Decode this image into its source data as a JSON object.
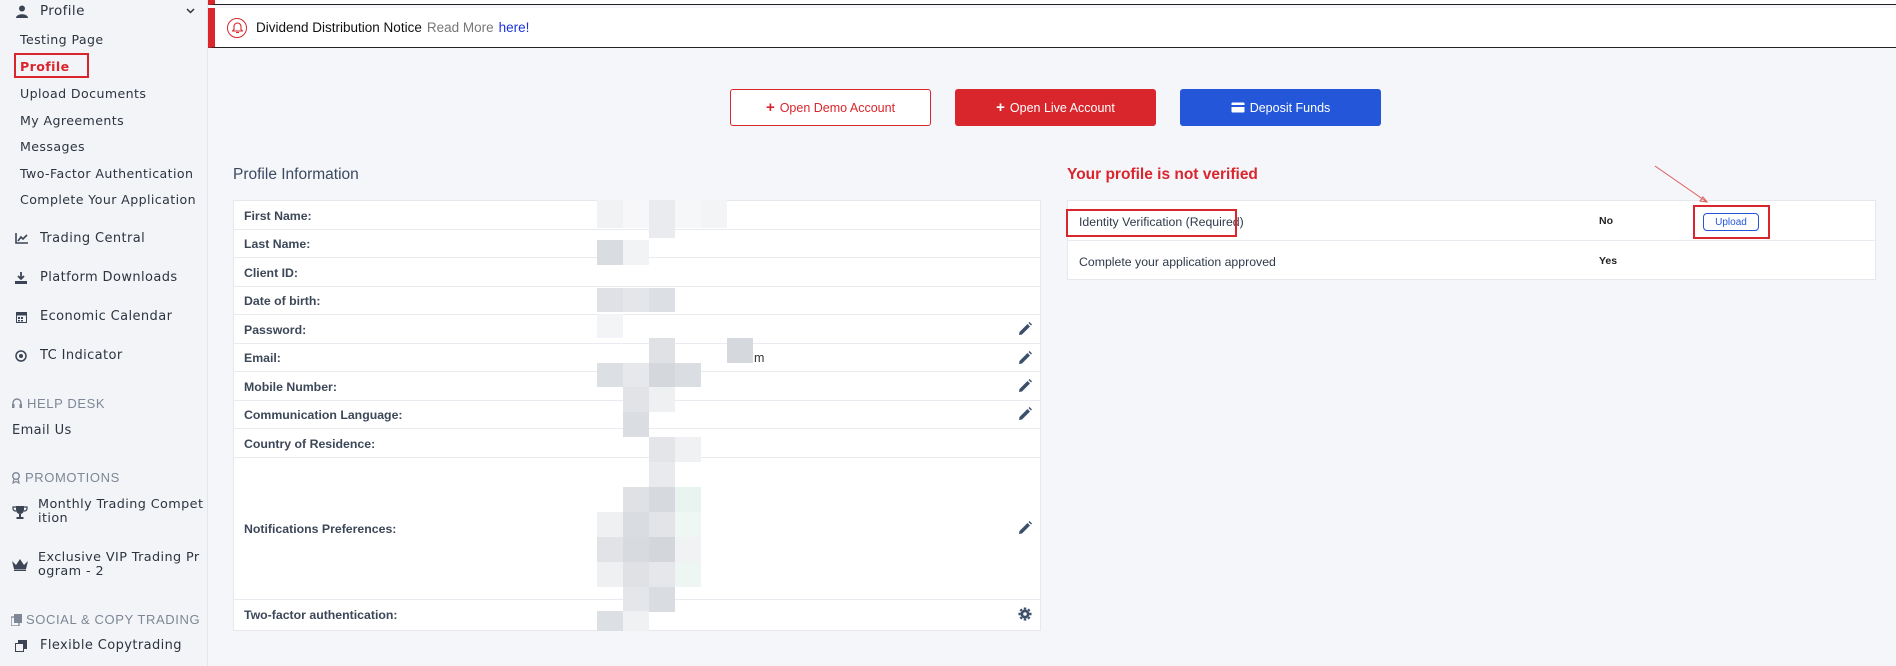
{
  "sidebar": {
    "profile_header": "Profile",
    "profile_sub": [
      "Testing Page",
      "Profile",
      "Upload Documents",
      "My Agreements",
      "Messages",
      "Two-Factor Authentication",
      "Complete Your Application"
    ],
    "main_items": [
      {
        "label": "Trading Central",
        "icon": "chart-icon"
      },
      {
        "label": "Platform Downloads",
        "icon": "download-icon"
      },
      {
        "label": "Economic Calendar",
        "icon": "calendar-icon"
      },
      {
        "label": "TC Indicator",
        "icon": "target-icon"
      }
    ],
    "help_desk": {
      "title": "HELP DESK",
      "items": [
        "Email Us"
      ]
    },
    "promotions": {
      "title": "PROMOTIONS",
      "items": [
        "Monthly Trading Compet\nition",
        "Exclusive VIP Trading Pr\nogram - 2"
      ]
    },
    "social": {
      "title": "SOCIAL & COPY TRADING",
      "items": [
        "Flexible Copytrading"
      ]
    }
  },
  "notice": {
    "title": "Dividend Distribution Notice",
    "read_more": "Read More",
    "link": "here!"
  },
  "actions": {
    "demo": "Open Demo Account",
    "live": "Open Live Account",
    "deposit": "Deposit Funds"
  },
  "profile": {
    "title": "Profile Information",
    "fields": [
      "First Name:",
      "Last Name:",
      "Client ID:",
      "Date of birth:",
      "Password:",
      "Email:",
      "Mobile Number:",
      "Communication Language:",
      "Country of Residence:",
      "Notifications Preferences:",
      "Two-factor authentication:"
    ],
    "email_tail": "m"
  },
  "verification": {
    "title": "Your profile is not verified",
    "rows": [
      {
        "label": "Identity Verification (Required)",
        "status": "No",
        "action": "Upload"
      },
      {
        "label": "Complete your application approved",
        "status": "Yes"
      }
    ]
  },
  "colors": {
    "accent_red": "#d9262d",
    "accent_blue": "#2356d9"
  }
}
